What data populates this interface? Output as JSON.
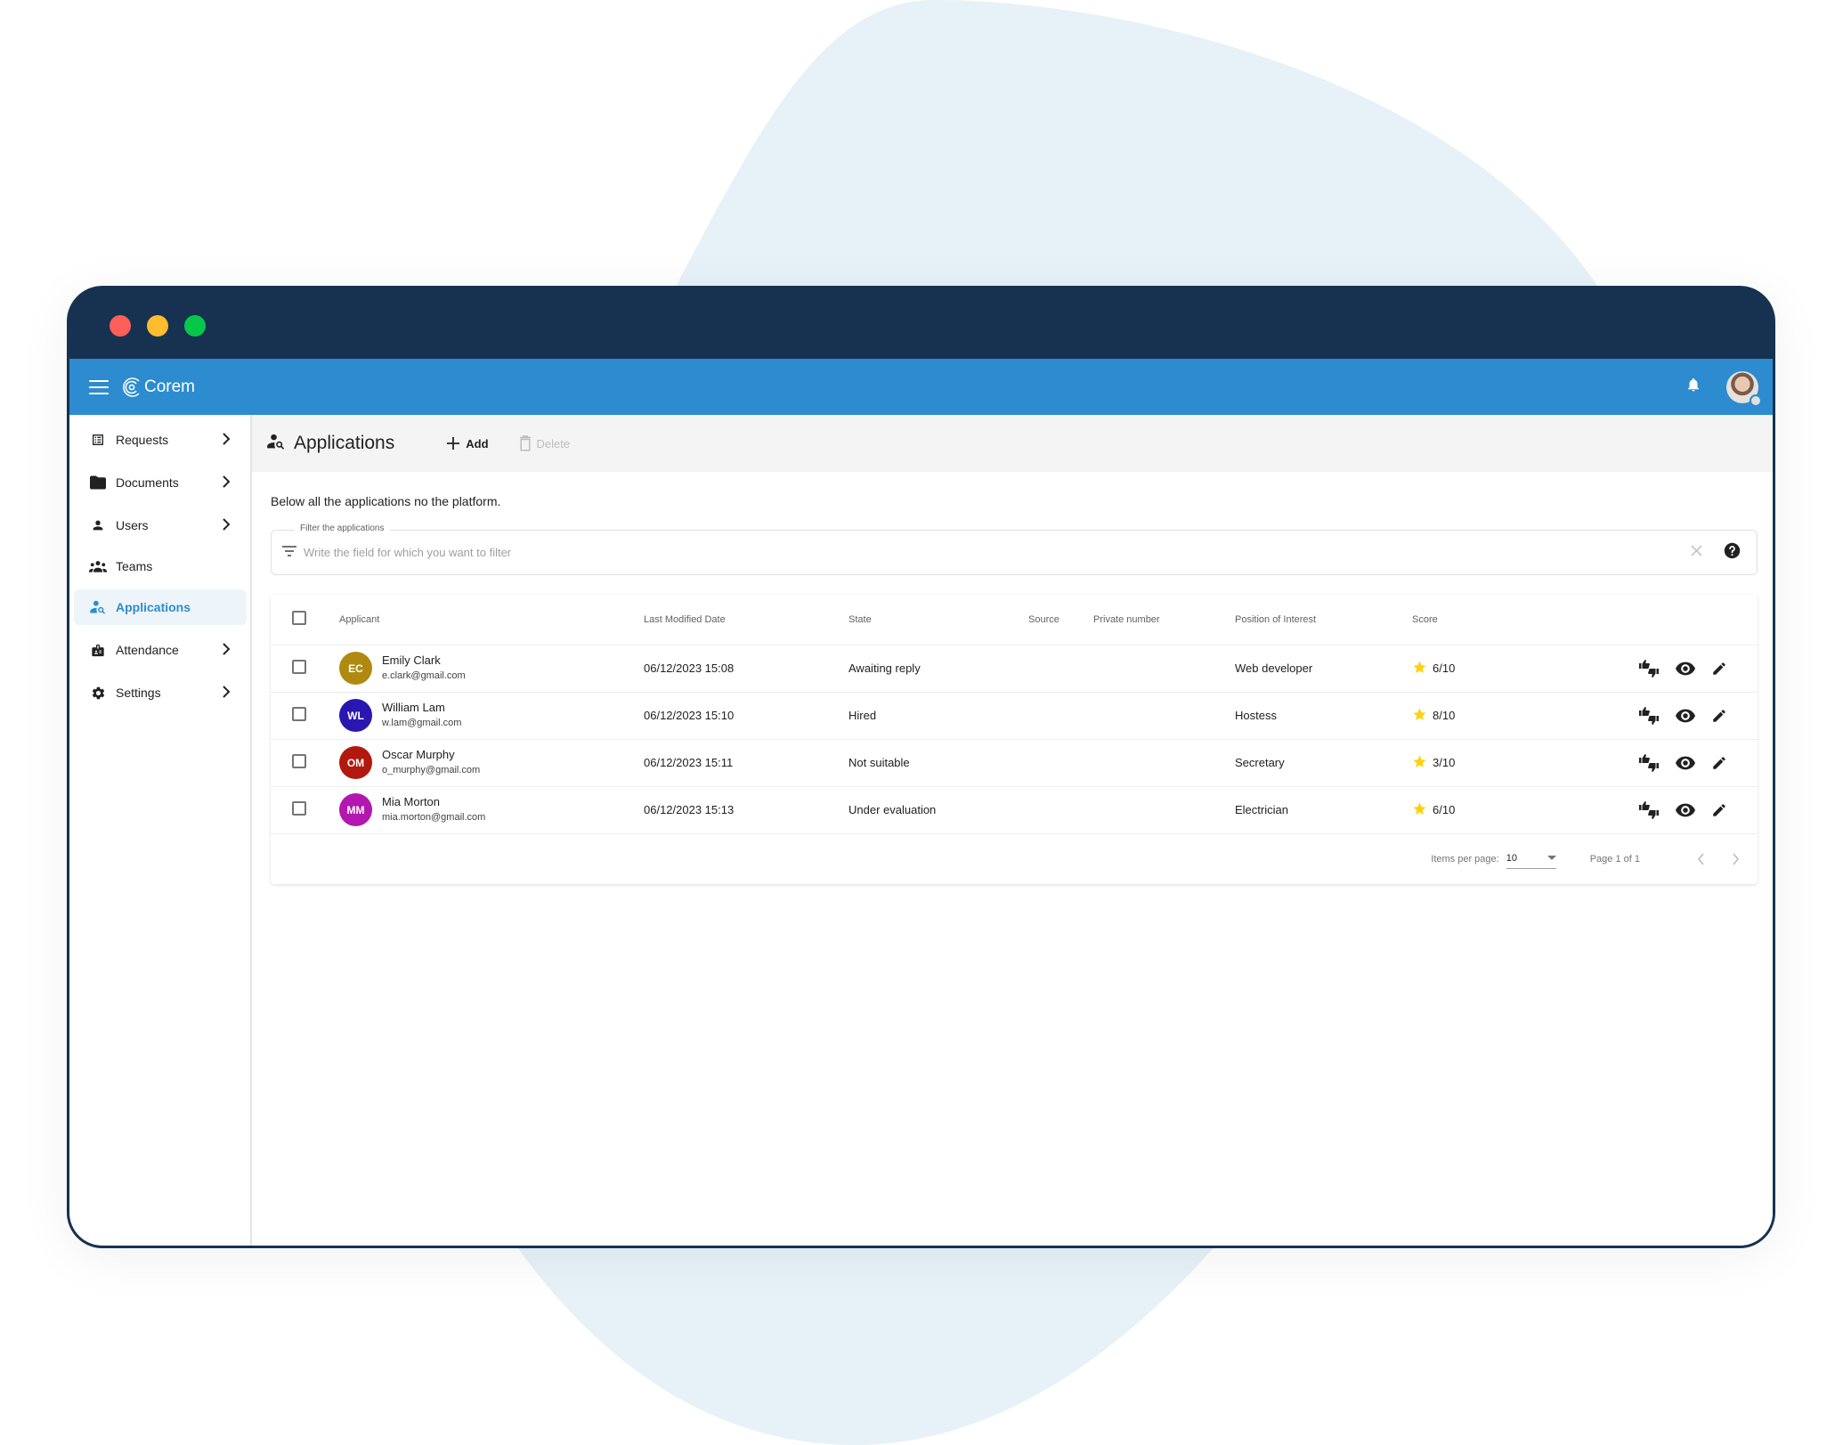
{
  "app": {
    "brand": "Corem",
    "colors": {
      "titlebar": "#163250",
      "appbar": "#2d8ccf",
      "accent": "#2d8ccf",
      "star": "#fdd20c",
      "blob": "#e6f1f8"
    }
  },
  "window": {
    "controls": [
      "close",
      "minimize",
      "maximize"
    ]
  },
  "appbar": {
    "menu_icon": "hamburger-icon",
    "notification_icon": "bell-icon",
    "user_avatar": "user-avatar-photo"
  },
  "sidebar": {
    "items": [
      {
        "label": "Requests",
        "icon": "list-alt-icon",
        "has_children": true,
        "active": false
      },
      {
        "label": "Documents",
        "icon": "folder-icon",
        "has_children": true,
        "active": false
      },
      {
        "label": "Users",
        "icon": "person-icon",
        "has_children": true,
        "active": false
      },
      {
        "label": "Teams",
        "icon": "groups-icon",
        "has_children": false,
        "active": false
      },
      {
        "label": "Applications",
        "icon": "person-search-icon",
        "has_children": false,
        "active": true
      },
      {
        "label": "Attendance",
        "icon": "badge-icon",
        "has_children": true,
        "active": false
      },
      {
        "label": "Settings",
        "icon": "gear-icon",
        "has_children": true,
        "active": false
      }
    ]
  },
  "page": {
    "title": "Applications",
    "add_label": "Add",
    "delete_label": "Delete",
    "description": "Below all the applications no the platform."
  },
  "filter": {
    "label": "Filter the applications",
    "placeholder": "Write the field for which you want to filter",
    "value": ""
  },
  "table": {
    "columns": [
      "Applicant",
      "Last Modified Date",
      "State",
      "Source",
      "Private number",
      "Position of Interest",
      "Score"
    ],
    "rows": [
      {
        "initials": "EC",
        "avatar_color": "#b08a10",
        "name": "Emily Clark",
        "email": "e.clark@gmail.com",
        "date": "06/12/2023 15:08",
        "state": "Awaiting reply",
        "source": "",
        "private_number": "",
        "position": "Web developer",
        "score": "6/10"
      },
      {
        "initials": "WL",
        "avatar_color": "#2a17b0",
        "name": "William Lam",
        "email": "w.lam@gmail.com",
        "date": "06/12/2023 15:10",
        "state": "Hired",
        "source": "",
        "private_number": "",
        "position": "Hostess",
        "score": "8/10"
      },
      {
        "initials": "OM",
        "avatar_color": "#b3180e",
        "name": "Oscar Murphy",
        "email": "o_murphy@gmail.com",
        "date": "06/12/2023 15:11",
        "state": "Not suitable",
        "source": "",
        "private_number": "",
        "position": "Secretary",
        "score": "3/10"
      },
      {
        "initials": "MM",
        "avatar_color": "#b317b0",
        "name": "Mia Morton",
        "email": "mia.morton@gmail.com",
        "date": "06/12/2023 15:13",
        "state": "Under evaluation",
        "source": "",
        "private_number": "",
        "position": "Electrician",
        "score": "6/10"
      }
    ],
    "row_actions": [
      "thumbs-up-down-icon",
      "eye-icon",
      "pencil-icon"
    ]
  },
  "paginator": {
    "items_per_page_label": "Items per page:",
    "items_per_page": "10",
    "range_label": "Page 1 of 1"
  }
}
